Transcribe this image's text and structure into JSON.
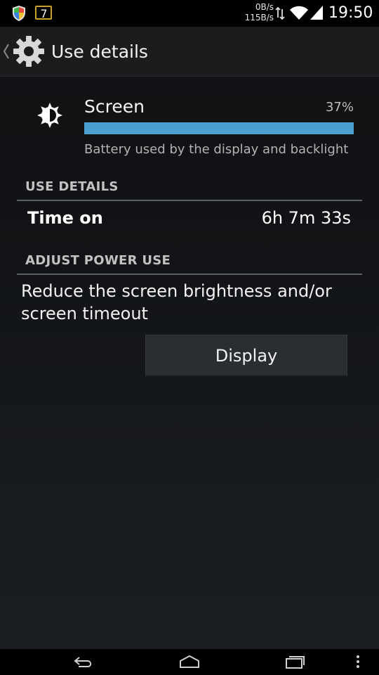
{
  "status_bar": {
    "notification_badge": "7",
    "rate_up": "0B/s",
    "rate_down": "115B/s",
    "time": "19:50",
    "icons": [
      "shield-icon",
      "notification-7-icon",
      "data-arrows-icon",
      "wifi-icon",
      "cell-signal-icon"
    ]
  },
  "action_bar": {
    "title": "Use details",
    "icons": [
      "back-chevron-icon",
      "settings-gear-icon"
    ]
  },
  "header": {
    "title": "Screen",
    "percent": "37%",
    "progress_fraction": 1.0,
    "description": "Battery used by the display and backlight",
    "icon": "brightness-icon"
  },
  "use_details": {
    "header": "USE DETAILS",
    "time_on_label": "Time on",
    "time_on_value": "6h 7m 33s"
  },
  "adjust_power": {
    "header": "ADJUST POWER USE",
    "text": "Reduce the screen brightness and/or screen timeout",
    "button_label": "Display"
  },
  "nav_bar": {
    "icons": [
      "nav-back-icon",
      "nav-home-icon",
      "nav-recents-icon",
      "nav-menu-icon"
    ]
  },
  "colors": {
    "accent": "#4aa0d0",
    "background": "#121417",
    "action_bar": "#1b1c1e"
  }
}
